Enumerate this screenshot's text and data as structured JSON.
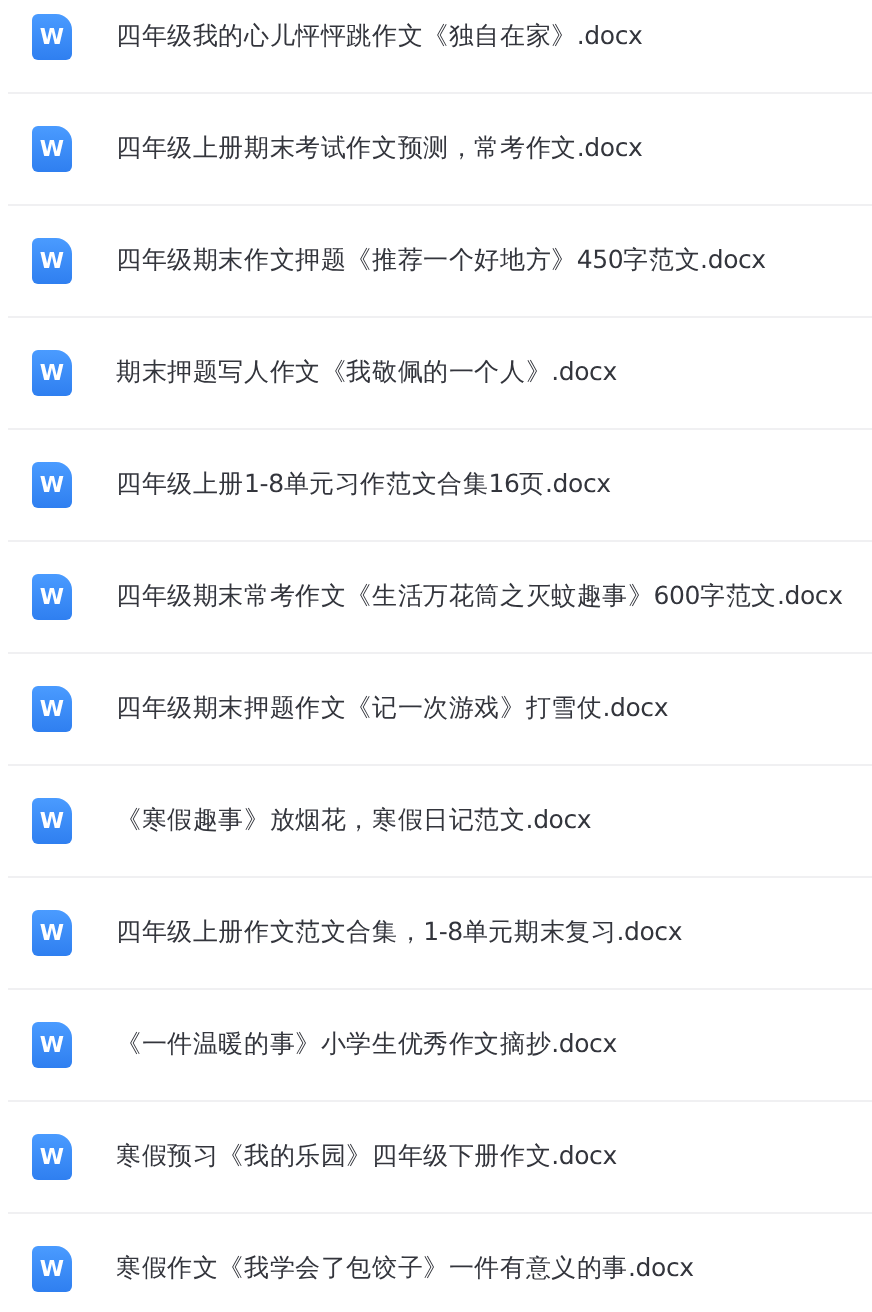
{
  "files": [
    {
      "icon_letter": "W",
      "name": "四年级我的心儿怦怦跳作文《独自在家》.docx"
    },
    {
      "icon_letter": "W",
      "name": "四年级上册期末考试作文预测，常考作文.docx"
    },
    {
      "icon_letter": "W",
      "name": "四年级期末作文押题《推荐一个好地方》450字范文.docx"
    },
    {
      "icon_letter": "W",
      "name": "期末押题写人作文《我敬佩的一个人》.docx"
    },
    {
      "icon_letter": "W",
      "name": "四年级上册1-8单元习作范文合集16页.docx"
    },
    {
      "icon_letter": "W",
      "name": "四年级期末常考作文《生活万花筒之灭蚊趣事》600字范文.docx"
    },
    {
      "icon_letter": "W",
      "name": "四年级期末押题作文《记一次游戏》打雪仗.docx"
    },
    {
      "icon_letter": "W",
      "name": "《寒假趣事》放烟花，寒假日记范文.docx"
    },
    {
      "icon_letter": "W",
      "name": "四年级上册作文范文合集，1-8单元期末复习.docx"
    },
    {
      "icon_letter": "W",
      "name": "《一件温暖的事》小学生优秀作文摘抄.docx"
    },
    {
      "icon_letter": "W",
      "name": "寒假预习《我的乐园》四年级下册作文.docx"
    },
    {
      "icon_letter": "W",
      "name": "寒假作文《我学会了包饺子》一件有意义的事.docx"
    }
  ]
}
